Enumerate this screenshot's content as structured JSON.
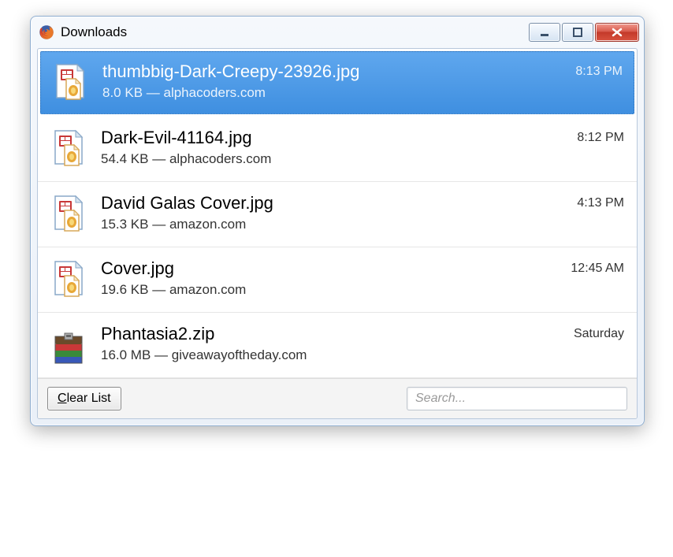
{
  "window": {
    "title": "Downloads"
  },
  "downloads": [
    {
      "name": "thumbbig-Dark-Creepy-23926.jpg",
      "size": "8.0 KB",
      "source": "alphacoders.com",
      "time": "8:13 PM",
      "iconType": "image",
      "selected": true
    },
    {
      "name": "Dark-Evil-41164.jpg",
      "size": "54.4 KB",
      "source": "alphacoders.com",
      "time": "8:12 PM",
      "iconType": "image",
      "selected": false
    },
    {
      "name": "David Galas Cover.jpg",
      "size": "15.3 KB",
      "source": "amazon.com",
      "time": "4:13 PM",
      "iconType": "image",
      "selected": false
    },
    {
      "name": "Cover.jpg",
      "size": "19.6 KB",
      "source": "amazon.com",
      "time": "12:45 AM",
      "iconType": "image",
      "selected": false
    },
    {
      "name": "Phantasia2.zip",
      "size": "16.0 MB",
      "source": "giveawayoftheday.com",
      "time": "Saturday",
      "iconType": "archive",
      "selected": false
    }
  ],
  "footer": {
    "clear_label": "Clear List",
    "search_placeholder": "Search..."
  }
}
